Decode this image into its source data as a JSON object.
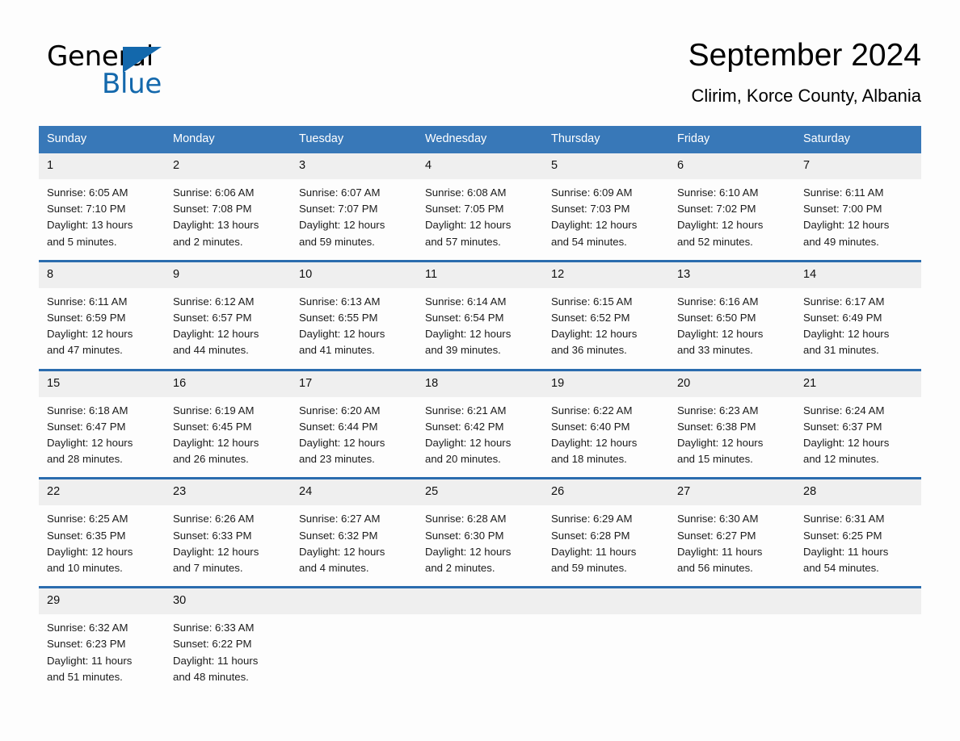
{
  "logo": {
    "word_one": "General",
    "word_two": "Blue",
    "triangle_icon": "triangle-icon",
    "brand_color": "#1368ac"
  },
  "header": {
    "title": "September 2024",
    "subtitle": "Clirim, Korce County, Albania"
  },
  "theme": {
    "header_blue": "#3878b8",
    "row_border_blue": "#2b6cae",
    "daynum_band": "#efefef",
    "page_background": "#fdfdfd"
  },
  "calendar": {
    "weekday_headers": [
      "Sunday",
      "Monday",
      "Tuesday",
      "Wednesday",
      "Thursday",
      "Friday",
      "Saturday"
    ],
    "weeks": [
      [
        {
          "day": "1",
          "sunrise": "Sunrise: 6:05 AM",
          "sunset": "Sunset: 7:10 PM",
          "daylight_1": "Daylight: 13 hours",
          "daylight_2": "and 5 minutes."
        },
        {
          "day": "2",
          "sunrise": "Sunrise: 6:06 AM",
          "sunset": "Sunset: 7:08 PM",
          "daylight_1": "Daylight: 13 hours",
          "daylight_2": "and 2 minutes."
        },
        {
          "day": "3",
          "sunrise": "Sunrise: 6:07 AM",
          "sunset": "Sunset: 7:07 PM",
          "daylight_1": "Daylight: 12 hours",
          "daylight_2": "and 59 minutes."
        },
        {
          "day": "4",
          "sunrise": "Sunrise: 6:08 AM",
          "sunset": "Sunset: 7:05 PM",
          "daylight_1": "Daylight: 12 hours",
          "daylight_2": "and 57 minutes."
        },
        {
          "day": "5",
          "sunrise": "Sunrise: 6:09 AM",
          "sunset": "Sunset: 7:03 PM",
          "daylight_1": "Daylight: 12 hours",
          "daylight_2": "and 54 minutes."
        },
        {
          "day": "6",
          "sunrise": "Sunrise: 6:10 AM",
          "sunset": "Sunset: 7:02 PM",
          "daylight_1": "Daylight: 12 hours",
          "daylight_2": "and 52 minutes."
        },
        {
          "day": "7",
          "sunrise": "Sunrise: 6:11 AM",
          "sunset": "Sunset: 7:00 PM",
          "daylight_1": "Daylight: 12 hours",
          "daylight_2": "and 49 minutes."
        }
      ],
      [
        {
          "day": "8",
          "sunrise": "Sunrise: 6:11 AM",
          "sunset": "Sunset: 6:59 PM",
          "daylight_1": "Daylight: 12 hours",
          "daylight_2": "and 47 minutes."
        },
        {
          "day": "9",
          "sunrise": "Sunrise: 6:12 AM",
          "sunset": "Sunset: 6:57 PM",
          "daylight_1": "Daylight: 12 hours",
          "daylight_2": "and 44 minutes."
        },
        {
          "day": "10",
          "sunrise": "Sunrise: 6:13 AM",
          "sunset": "Sunset: 6:55 PM",
          "daylight_1": "Daylight: 12 hours",
          "daylight_2": "and 41 minutes."
        },
        {
          "day": "11",
          "sunrise": "Sunrise: 6:14 AM",
          "sunset": "Sunset: 6:54 PM",
          "daylight_1": "Daylight: 12 hours",
          "daylight_2": "and 39 minutes."
        },
        {
          "day": "12",
          "sunrise": "Sunrise: 6:15 AM",
          "sunset": "Sunset: 6:52 PM",
          "daylight_1": "Daylight: 12 hours",
          "daylight_2": "and 36 minutes."
        },
        {
          "day": "13",
          "sunrise": "Sunrise: 6:16 AM",
          "sunset": "Sunset: 6:50 PM",
          "daylight_1": "Daylight: 12 hours",
          "daylight_2": "and 33 minutes."
        },
        {
          "day": "14",
          "sunrise": "Sunrise: 6:17 AM",
          "sunset": "Sunset: 6:49 PM",
          "daylight_1": "Daylight: 12 hours",
          "daylight_2": "and 31 minutes."
        }
      ],
      [
        {
          "day": "15",
          "sunrise": "Sunrise: 6:18 AM",
          "sunset": "Sunset: 6:47 PM",
          "daylight_1": "Daylight: 12 hours",
          "daylight_2": "and 28 minutes."
        },
        {
          "day": "16",
          "sunrise": "Sunrise: 6:19 AM",
          "sunset": "Sunset: 6:45 PM",
          "daylight_1": "Daylight: 12 hours",
          "daylight_2": "and 26 minutes."
        },
        {
          "day": "17",
          "sunrise": "Sunrise: 6:20 AM",
          "sunset": "Sunset: 6:44 PM",
          "daylight_1": "Daylight: 12 hours",
          "daylight_2": "and 23 minutes."
        },
        {
          "day": "18",
          "sunrise": "Sunrise: 6:21 AM",
          "sunset": "Sunset: 6:42 PM",
          "daylight_1": "Daylight: 12 hours",
          "daylight_2": "and 20 minutes."
        },
        {
          "day": "19",
          "sunrise": "Sunrise: 6:22 AM",
          "sunset": "Sunset: 6:40 PM",
          "daylight_1": "Daylight: 12 hours",
          "daylight_2": "and 18 minutes."
        },
        {
          "day": "20",
          "sunrise": "Sunrise: 6:23 AM",
          "sunset": "Sunset: 6:38 PM",
          "daylight_1": "Daylight: 12 hours",
          "daylight_2": "and 15 minutes."
        },
        {
          "day": "21",
          "sunrise": "Sunrise: 6:24 AM",
          "sunset": "Sunset: 6:37 PM",
          "daylight_1": "Daylight: 12 hours",
          "daylight_2": "and 12 minutes."
        }
      ],
      [
        {
          "day": "22",
          "sunrise": "Sunrise: 6:25 AM",
          "sunset": "Sunset: 6:35 PM",
          "daylight_1": "Daylight: 12 hours",
          "daylight_2": "and 10 minutes."
        },
        {
          "day": "23",
          "sunrise": "Sunrise: 6:26 AM",
          "sunset": "Sunset: 6:33 PM",
          "daylight_1": "Daylight: 12 hours",
          "daylight_2": "and 7 minutes."
        },
        {
          "day": "24",
          "sunrise": "Sunrise: 6:27 AM",
          "sunset": "Sunset: 6:32 PM",
          "daylight_1": "Daylight: 12 hours",
          "daylight_2": "and 4 minutes."
        },
        {
          "day": "25",
          "sunrise": "Sunrise: 6:28 AM",
          "sunset": "Sunset: 6:30 PM",
          "daylight_1": "Daylight: 12 hours",
          "daylight_2": "and 2 minutes."
        },
        {
          "day": "26",
          "sunrise": "Sunrise: 6:29 AM",
          "sunset": "Sunset: 6:28 PM",
          "daylight_1": "Daylight: 11 hours",
          "daylight_2": "and 59 minutes."
        },
        {
          "day": "27",
          "sunrise": "Sunrise: 6:30 AM",
          "sunset": "Sunset: 6:27 PM",
          "daylight_1": "Daylight: 11 hours",
          "daylight_2": "and 56 minutes."
        },
        {
          "day": "28",
          "sunrise": "Sunrise: 6:31 AM",
          "sunset": "Sunset: 6:25 PM",
          "daylight_1": "Daylight: 11 hours",
          "daylight_2": "and 54 minutes."
        }
      ],
      [
        {
          "day": "29",
          "sunrise": "Sunrise: 6:32 AM",
          "sunset": "Sunset: 6:23 PM",
          "daylight_1": "Daylight: 11 hours",
          "daylight_2": "and 51 minutes."
        },
        {
          "day": "30",
          "sunrise": "Sunrise: 6:33 AM",
          "sunset": "Sunset: 6:22 PM",
          "daylight_1": "Daylight: 11 hours",
          "daylight_2": "and 48 minutes."
        },
        {
          "day": "",
          "sunrise": "",
          "sunset": "",
          "daylight_1": "",
          "daylight_2": ""
        },
        {
          "day": "",
          "sunrise": "",
          "sunset": "",
          "daylight_1": "",
          "daylight_2": ""
        },
        {
          "day": "",
          "sunrise": "",
          "sunset": "",
          "daylight_1": "",
          "daylight_2": ""
        },
        {
          "day": "",
          "sunrise": "",
          "sunset": "",
          "daylight_1": "",
          "daylight_2": ""
        },
        {
          "day": "",
          "sunrise": "",
          "sunset": "",
          "daylight_1": "",
          "daylight_2": ""
        }
      ]
    ]
  }
}
